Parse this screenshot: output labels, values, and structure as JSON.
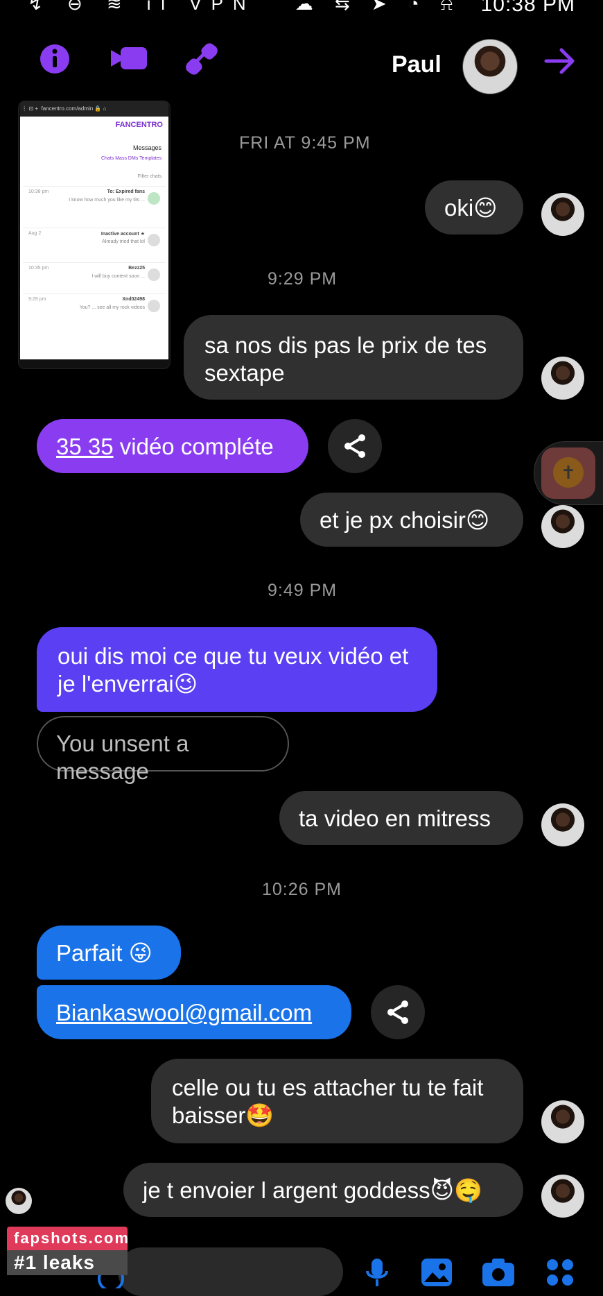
{
  "status_bar": {
    "time": "10:38 PM",
    "system_icons": "↯ ⊖ ≋ ıl VPN",
    "notification_icons": "☁ ⇆ ➤ ◔ ⍾"
  },
  "header": {
    "contact_name": "Paul",
    "info_icon": "info-icon",
    "video_icon": "video-camera-icon",
    "call_icon": "phone-icon",
    "back_icon": "arrow-icon",
    "accent_color": "#8a3df0"
  },
  "thumbnail": {
    "url": "fancentro.com/admin",
    "brand": "FANCENTRO",
    "title": "Messages",
    "tabs": "Chats   Mass DMs   Templates",
    "filter": "Filter chats",
    "rows": [
      {
        "name": "To: Expired fans",
        "preview": "I know how much you like my tits ...",
        "time": "10:38 pm"
      },
      {
        "name": "Inactive account ★",
        "preview": "Already tried that lol",
        "time": "Aug 2"
      },
      {
        "name": "Bezz25",
        "preview": "I will buy content soon ...",
        "time": "10:35 pm"
      },
      {
        "name": "Xnd02498",
        "preview": "You? ... see all my rock videos",
        "time": "9:29 pm"
      }
    ]
  },
  "timestamps": {
    "t1": "FRI AT 9:45 PM",
    "t2": "9:29 PM",
    "t3": "9:49 PM",
    "t4": "10:26 PM"
  },
  "messages": {
    "m1": "oki😊",
    "m2": "sa nos dis pas le prix de tes sextape",
    "m3_price": "35 35",
    "m3_rest": " vidéo compléte",
    "m4": "et je px choisir😊",
    "m5": "oui dis moi ce que tu veux vidéo et je l'enverrai😉",
    "m6": "You unsent a message",
    "m7": "ta video en mitress",
    "m8": "Parfait 😜",
    "m9": "Biankaswool@gmail.com",
    "m10": "celle ou tu es attacher tu te fait baisser🤩",
    "m11": "je t envoier l argent goddess😈🤤"
  },
  "watermark": {
    "line1": "fapshots.com",
    "line2": "#1 leaks"
  }
}
